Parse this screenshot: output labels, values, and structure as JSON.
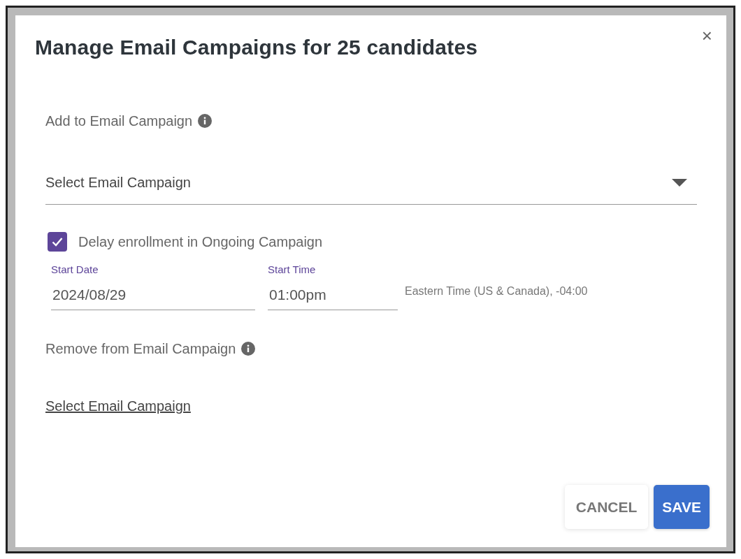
{
  "dialog": {
    "title": "Manage Email Campaigns for 25 candidates",
    "close": "×"
  },
  "add_section": {
    "label": "Add to Email Campaign",
    "select": {
      "placeholder": "Select Email Campaign"
    }
  },
  "delay": {
    "label": "Delay enrollment in Ongoing Campaign",
    "checked": true
  },
  "start_date": {
    "label": "Start Date",
    "value": "2024/08/29"
  },
  "start_time": {
    "label": "Start Time",
    "value": "01:00pm"
  },
  "timezone": "Eastern Time (US & Canada), -04:00",
  "remove_section": {
    "label": "Remove from Email Campaign",
    "link": "Select Email Campaign"
  },
  "buttons": [
    {
      "label": "CANCEL",
      "kind": "secondary"
    },
    {
      "label": "SAVE",
      "kind": "primary"
    }
  ]
}
